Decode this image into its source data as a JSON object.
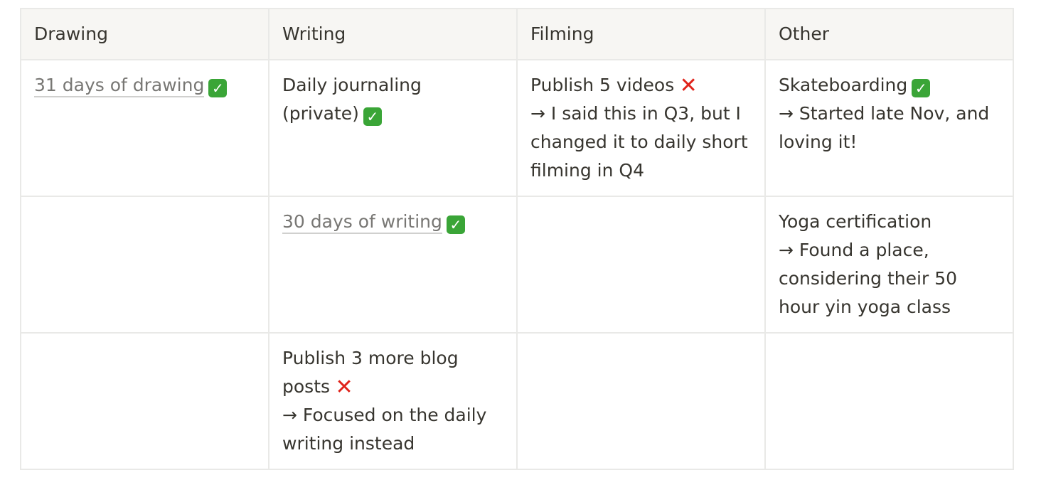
{
  "table": {
    "headers": [
      "Drawing",
      "Writing",
      "Filming",
      "Other"
    ],
    "rows": [
      {
        "drawing": {
          "link_text": "31 days of drawing",
          "status": "check"
        },
        "writing": {
          "text": "Daily journaling (private)",
          "status": "check"
        },
        "filming": {
          "text": "Publish 5 videos",
          "status": "cross",
          "note": "→ I said this in Q3, but I changed it to daily short filming in Q4"
        },
        "other": {
          "text": "Skateboarding",
          "status": "check",
          "note": "→ Started late Nov, and loving it!"
        }
      },
      {
        "drawing": {},
        "writing": {
          "link_text": "30 days of writing",
          "status": "check"
        },
        "filming": {},
        "other": {
          "text": "Yoga certification",
          "note": "→ Found a place, considering their 50 hour yin yoga class"
        }
      },
      {
        "drawing": {},
        "writing": {
          "text": "Publish 3 more blog posts",
          "status": "cross",
          "note": "→ Focused on the daily writing instead"
        },
        "filming": {},
        "other": {}
      }
    ]
  },
  "icons": {
    "check": {
      "name": "check-mark-icon",
      "glyph": "✓",
      "color": "#3aa537"
    },
    "cross": {
      "name": "cross-mark-icon",
      "glyph": "✕",
      "color": "#e0231a"
    }
  }
}
